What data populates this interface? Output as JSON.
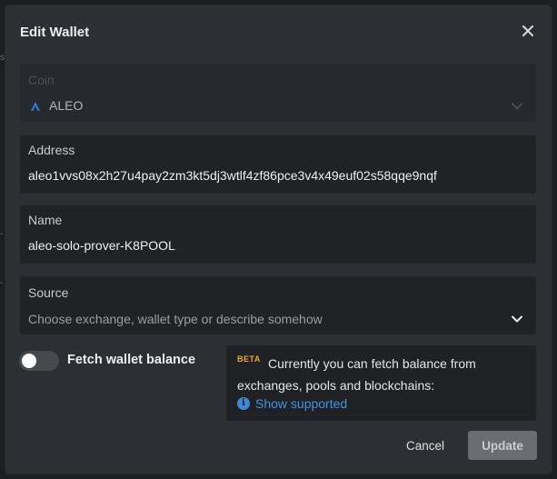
{
  "modal": {
    "title": "Edit Wallet",
    "close_icon": "close-icon"
  },
  "coin": {
    "label": "Coin",
    "value": "ALEO",
    "icon": "aleo-logo-icon",
    "disabled": true
  },
  "address": {
    "label": "Address",
    "value": "aleo1vvs08x2h27u4pay2zm3kt5dj3wtlf4zf86pce3v4x49euf02s58qqe9nqf"
  },
  "name": {
    "label": "Name",
    "value": "aleo-solo-prover-K8POOL"
  },
  "source": {
    "label": "Source",
    "placeholder": "Choose exchange, wallet type or describe somehow"
  },
  "fetch_balance": {
    "label": "Fetch wallet balance",
    "enabled": false
  },
  "info": {
    "badge": "BETA",
    "line1": "Currently you can fetch balance from",
    "line2": "exchanges, pools and blockchains:",
    "link": "Show supported",
    "link_icon": "info-icon"
  },
  "actions": {
    "cancel": "Cancel",
    "update": "Update"
  },
  "colors": {
    "modal_bg": "#2c2f33",
    "field_bg": "#202225",
    "beta": "#f0a928",
    "link": "#3e96e8",
    "update_button": "#6a6e73"
  }
}
